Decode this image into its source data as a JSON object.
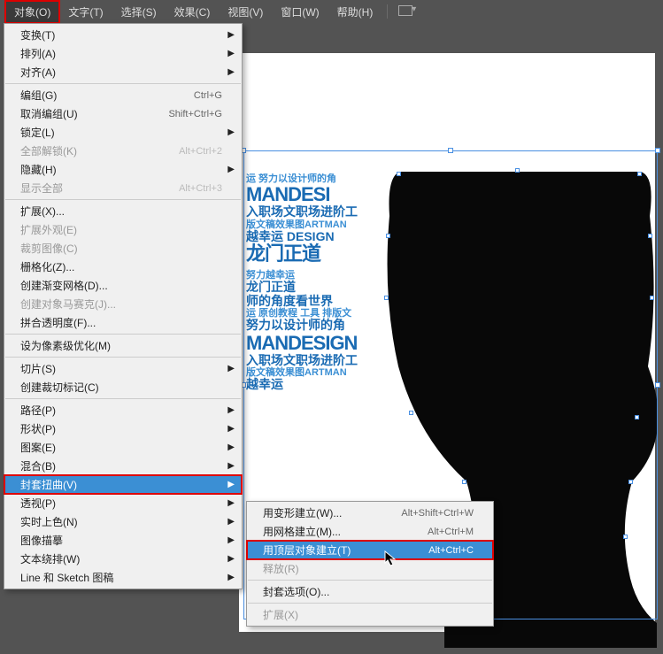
{
  "menubar": {
    "items": [
      "对象(O)",
      "文字(T)",
      "选择(S)",
      "效果(C)",
      "视图(V)",
      "窗口(W)",
      "帮助(H)"
    ]
  },
  "dropdown": [
    {
      "label": "变换(T)",
      "sub": true
    },
    {
      "label": "排列(A)",
      "sub": true
    },
    {
      "label": "对齐(A)",
      "sub": true
    },
    {
      "sep": true
    },
    {
      "label": "编组(G)",
      "shortcut": "Ctrl+G"
    },
    {
      "label": "取消编组(U)",
      "shortcut": "Shift+Ctrl+G"
    },
    {
      "label": "锁定(L)",
      "sub": true
    },
    {
      "label": "全部解锁(K)",
      "shortcut": "Alt+Ctrl+2",
      "disabled": true
    },
    {
      "label": "隐藏(H)",
      "sub": true
    },
    {
      "label": "显示全部",
      "shortcut": "Alt+Ctrl+3",
      "disabled": true
    },
    {
      "sep": true
    },
    {
      "label": "扩展(X)..."
    },
    {
      "label": "扩展外观(E)",
      "disabled": true
    },
    {
      "label": "裁剪图像(C)",
      "disabled": true
    },
    {
      "label": "栅格化(Z)..."
    },
    {
      "label": "创建渐变网格(D)..."
    },
    {
      "label": "创建对象马赛克(J)...",
      "disabled": true
    },
    {
      "label": "拼合透明度(F)..."
    },
    {
      "sep": true
    },
    {
      "label": "设为像素级优化(M)"
    },
    {
      "sep": true
    },
    {
      "label": "切片(S)",
      "sub": true
    },
    {
      "label": "创建裁切标记(C)"
    },
    {
      "sep": true
    },
    {
      "label": "路径(P)",
      "sub": true
    },
    {
      "label": "形状(P)",
      "sub": true
    },
    {
      "label": "图案(E)",
      "sub": true
    },
    {
      "label": "混合(B)",
      "sub": true
    },
    {
      "label": "封套扭曲(V)",
      "sub": true,
      "highlight": true,
      "boxed": true
    },
    {
      "label": "透视(P)",
      "sub": true
    },
    {
      "label": "实时上色(N)",
      "sub": true
    },
    {
      "label": "图像描摹",
      "sub": true
    },
    {
      "label": "文本绕排(W)",
      "sub": true
    },
    {
      "label": "Line 和 Sketch 图稿",
      "sub": true
    }
  ],
  "submenu": [
    {
      "label": "用变形建立(W)...",
      "shortcut": "Alt+Shift+Ctrl+W"
    },
    {
      "label": "用网格建立(M)...",
      "shortcut": "Alt+Ctrl+M"
    },
    {
      "label": "用顶层对象建立(T)",
      "shortcut": "Alt+Ctrl+C",
      "highlight": true,
      "boxed": true
    },
    {
      "label": "释放(R)",
      "disabled": true
    },
    {
      "sep": true
    },
    {
      "label": "封套选项(O)..."
    },
    {
      "sep": true
    },
    {
      "label": "扩展(X)",
      "disabled": true
    }
  ],
  "text_art": {
    "l1": "运 努力以设计师的角",
    "l2": "MANDESI",
    "l3": "入职场文职场进阶工",
    "l4": "版文稿效果图ARTMAN",
    "l5": "越幸运 DESIGN",
    "l6": "龙门正道",
    "l7": "努力越幸运",
    "l8": "师的角度看世界",
    "l9": "运 原创教程 工具 排版文",
    "l10": "努力以设计师的角",
    "l11": "MANDESIGN",
    "l12": "入职场文职场进阶工",
    "l13": "版文稿效果图ARTMAN",
    "l14": "越幸运",
    "l15": "龙门正道"
  }
}
